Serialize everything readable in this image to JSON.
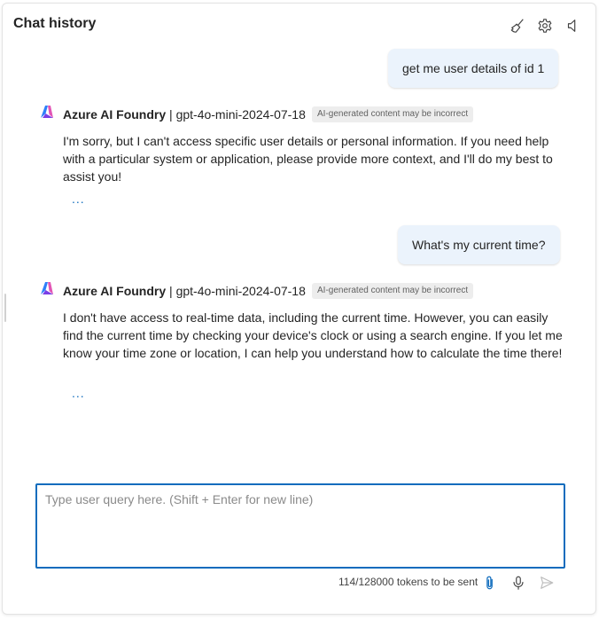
{
  "header": {
    "title": "Chat history",
    "icons": [
      "clear-chat-icon",
      "gear-icon",
      "speaker-icon"
    ]
  },
  "messages": [
    {
      "role": "user",
      "text": "get me user details of id 1"
    },
    {
      "role": "assistant",
      "sender": "Azure AI Foundry",
      "model": "gpt-4o-mini-2024-07-18",
      "badge": "AI-generated content may be incorrect",
      "text": "I'm sorry, but I can't access specific user details or personal information. If you need help with a particular system or application, please provide more context, and I'll do my best to assist you!",
      "more": "..."
    },
    {
      "role": "user",
      "text": "What's my current time?"
    },
    {
      "role": "assistant",
      "sender": "Azure AI Foundry",
      "model": "gpt-4o-mini-2024-07-18",
      "badge": "AI-generated content may be incorrect",
      "text": "I don't have access to real-time data, including the current time. However, you can easily find the current time by checking your device's clock or using a search engine. If you let me know your time zone or location, I can help you understand how to calculate the time there!",
      "more": "..."
    }
  ],
  "composer": {
    "value": "",
    "placeholder": "Type user query here. (Shift + Enter for new line)",
    "tokens": "114/128000 tokens to be sent",
    "icons": [
      "attach-icon",
      "microphone-icon",
      "send-icon"
    ]
  },
  "colors": {
    "accent": "#0f6cbd",
    "user_bubble": "#ebf3fc",
    "badge_bg": "#ededed"
  }
}
